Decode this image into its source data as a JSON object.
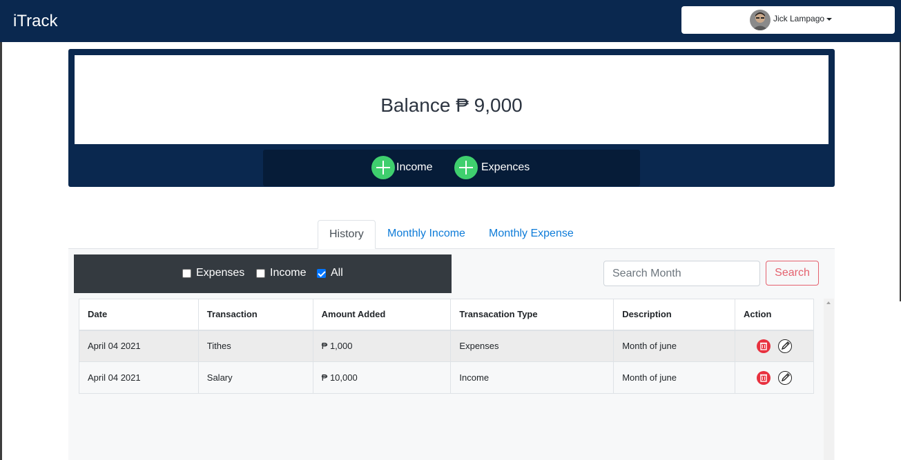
{
  "navbar": {
    "brand": "iTrack",
    "user_name": "Jick Lampago"
  },
  "balance": {
    "text": "Balance ₱ 9,000"
  },
  "actions": {
    "income_label": "Income",
    "expense_label": "Expences"
  },
  "tabs": [
    {
      "label": "History",
      "active": true
    },
    {
      "label": "Monthly Income",
      "active": false
    },
    {
      "label": "Monthly Expense",
      "active": false
    }
  ],
  "filters": {
    "expenses_label": "Expenses",
    "income_label": "Income",
    "all_label": "All",
    "checked": "All"
  },
  "search": {
    "placeholder": "Search Month",
    "button_label": "Search"
  },
  "table": {
    "headers": [
      "Date",
      "Transaction",
      "Amount Added",
      "Transacation Type",
      "Description",
      "Action"
    ],
    "rows": [
      {
        "date": "April 04 2021",
        "transaction": "Tithes",
        "amount": "₱ 1,000",
        "type": "Expenses",
        "description": "Month of june"
      },
      {
        "date": "April 04 2021",
        "transaction": "Salary",
        "amount": "₱ 10,000",
        "type": "Income",
        "description": "Month of june"
      }
    ]
  },
  "colors": {
    "navy": "#0a284f",
    "green": "#3fcf6e",
    "danger": "#e8313f",
    "link": "#0d7bd8"
  }
}
